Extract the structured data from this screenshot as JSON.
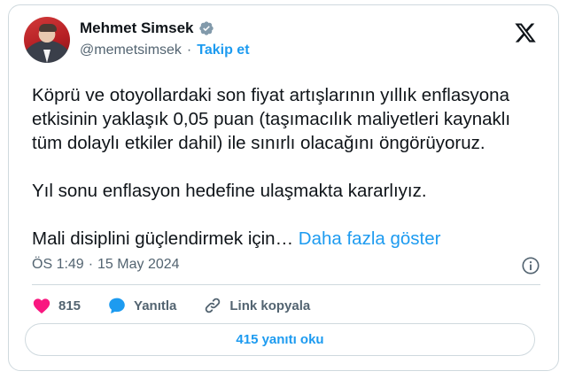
{
  "author": {
    "name": "Mehmet Simsek",
    "handle": "@memetsimsek",
    "separator": "·",
    "follow_label": "Takip et"
  },
  "tweet": {
    "text": "Köprü ve otoyollardaki son fiyat artışlarının yıllık enflasyona\netkisinin yaklaşık 0,05 puan (taşımacılık maliyetleri kaynaklı\ntüm dolaylı etkiler dahil) ile sınırlı olacağını öngörüyoruz.\n\nYıl sonu enflasyon hedefine ulaşmakta kararlıyız.\n\nMali disiplini güçlendirmek için… ",
    "show_more_label": "Daha fazla göster",
    "time": "ÖS 1:49",
    "separator": "·",
    "date": "15 May 2024"
  },
  "actions": {
    "like_count": "815",
    "reply_label": "Yanıtla",
    "copy_link_label": "Link kopyala"
  },
  "read_replies_label": "415 yanıtı oku",
  "colors": {
    "accent": "#1d9bf0",
    "like": "#f91880",
    "muted": "#536471",
    "border": "#cfd9de"
  },
  "icons": {
    "verified": "verified-badge-icon",
    "brand": "x-logo-icon",
    "info": "info-icon",
    "like": "heart-icon",
    "reply": "speech-bubble-icon",
    "link": "link-icon"
  }
}
